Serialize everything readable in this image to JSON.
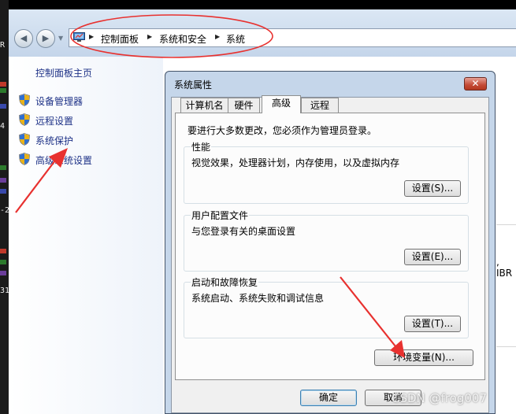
{
  "edge": {
    "frag1": "R",
    "frag2": "4",
    "frag3": "-2",
    "frag4": "31"
  },
  "address_bar": {
    "crumbs": [
      "控制面板",
      "系统和安全",
      "系统"
    ]
  },
  "sidebar": {
    "home_link": "控制面板主页",
    "items": [
      {
        "label": "设备管理器",
        "icon": "shield-icon"
      },
      {
        "label": "远程设置",
        "icon": "shield-icon"
      },
      {
        "label": "系统保护",
        "icon": "shield-icon"
      },
      {
        "label": "高级系统设置",
        "icon": "shield-icon"
      }
    ]
  },
  "background_fragment": ", IBR",
  "dialog": {
    "title": "系统属性",
    "close_label": "✕",
    "tabs": [
      {
        "label": "计算机名",
        "active": false
      },
      {
        "label": "硬件",
        "active": false
      },
      {
        "label": "高级",
        "active": true
      },
      {
        "label": "远程",
        "active": false
      }
    ],
    "admin_note": "要进行大多数更改，您必须作为管理员登录。",
    "groups": {
      "performance": {
        "title": "性能",
        "desc": "视觉效果，处理器计划，内存使用，以及虚拟内存",
        "button": "设置(S)..."
      },
      "profiles": {
        "title": "用户配置文件",
        "desc": "与您登录有关的桌面设置",
        "button": "设置(E)..."
      },
      "startup": {
        "title": "启动和故障恢复",
        "desc": "系统启动、系统失败和调试信息",
        "button": "设置(T)..."
      }
    },
    "env_button": "环境变量(N)...",
    "ok_button": "确定",
    "cancel_button": "取消"
  },
  "watermark": "CSDN @frog007",
  "colors": {
    "annotation_red": "#e8312f",
    "link_blue": "#1e3287",
    "accent": "#3c7fb1"
  }
}
